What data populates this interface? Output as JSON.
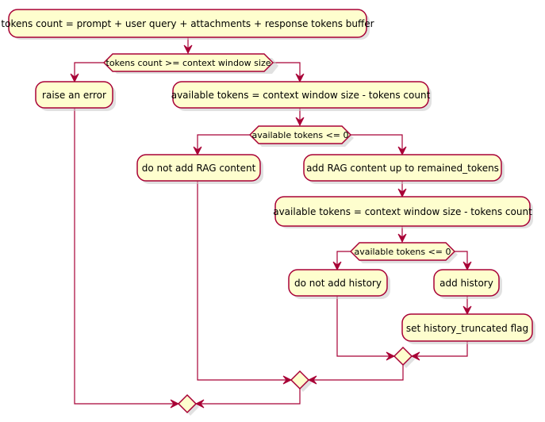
{
  "diagram": {
    "type": "activity",
    "colors": {
      "node_fill": "#FEFECE",
      "border": "#A80036",
      "background": "#FFFFFF"
    },
    "actions": {
      "tokens_count": "tokens count = prompt + user query + attachments + response tokens buffer",
      "raise_error": "raise an error",
      "available_tokens_1": "available tokens = context window size - tokens count",
      "no_rag": "do not add RAG content",
      "add_rag": "add RAG content up to remained_tokens",
      "available_tokens_2": "available tokens = context window size - tokens count",
      "no_history": "do not add history",
      "add_history": "add history",
      "set_flag": "set history_truncated flag"
    },
    "decisions": {
      "d1": "tokens count >= context window size",
      "d2": "available tokens <= 0",
      "d3": "available tokens <= 0"
    }
  }
}
